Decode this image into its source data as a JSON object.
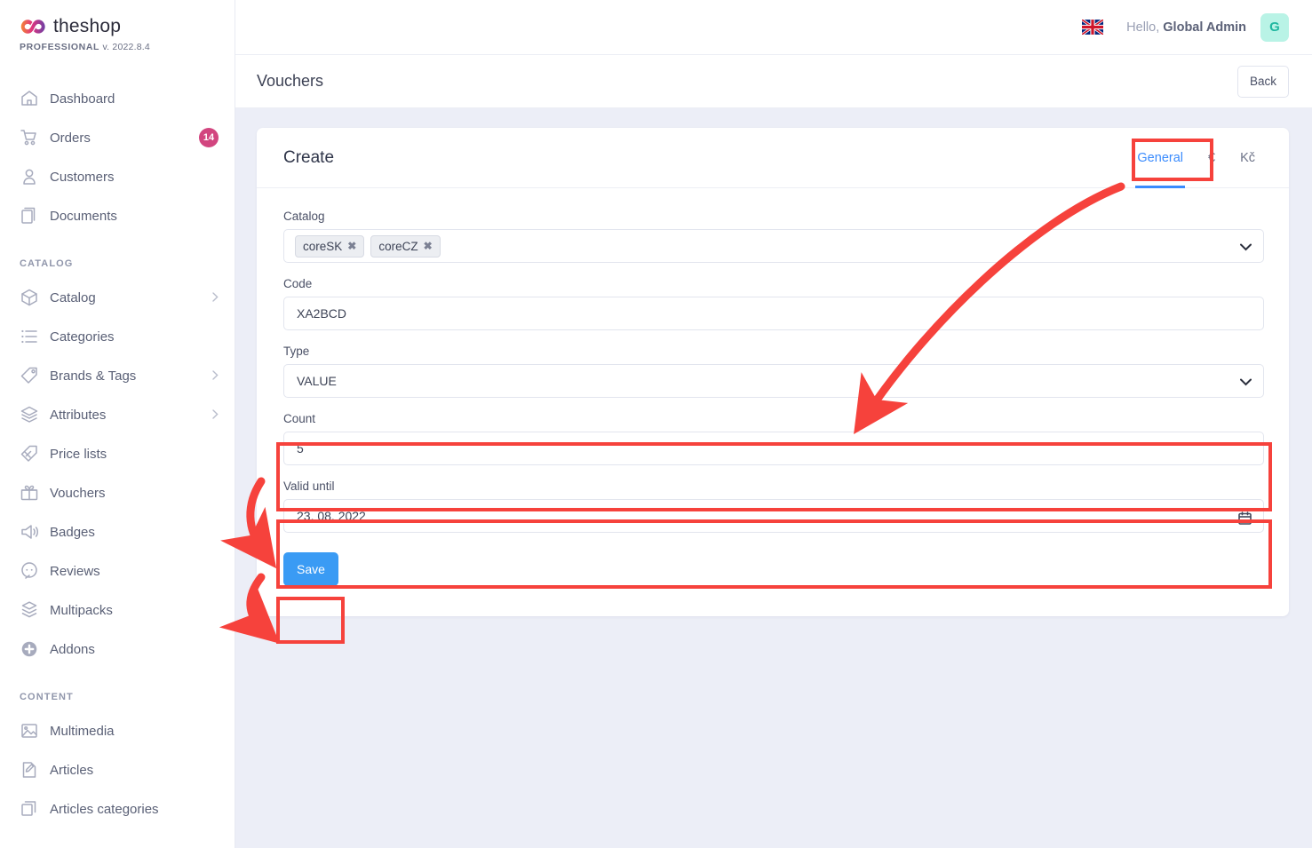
{
  "brand": {
    "name": "theshop",
    "edition": "PROFESSIONAL",
    "version": "v. 2022.8.4",
    "logo_colors": {
      "left": "#f06a3c",
      "mid": "#d63a8f",
      "right": "#6b3fa0"
    }
  },
  "topbar": {
    "language_icon": "uk-flag-icon",
    "greeting_prefix": "Hello,",
    "user_name": "Global Admin",
    "avatar_initial": "G",
    "avatar_bg": "#b9f3e6",
    "avatar_fg": "#20b7a0"
  },
  "page": {
    "title": "Vouchers",
    "back_label": "Back"
  },
  "sidebar": {
    "groups": [
      {
        "label": "",
        "items": [
          {
            "label": "Dashboard",
            "icon": "home-icon",
            "badge": null,
            "chevron": false
          },
          {
            "label": "Orders",
            "icon": "cart-icon",
            "badge": "14",
            "chevron": false
          },
          {
            "label": "Customers",
            "icon": "user-icon",
            "badge": null,
            "chevron": false
          },
          {
            "label": "Documents",
            "icon": "documents-icon",
            "badge": null,
            "chevron": false
          }
        ]
      },
      {
        "label": "CATALOG",
        "items": [
          {
            "label": "Catalog",
            "icon": "box-icon",
            "badge": null,
            "chevron": true
          },
          {
            "label": "Categories",
            "icon": "list-icon",
            "badge": null,
            "chevron": false
          },
          {
            "label": "Brands & Tags",
            "icon": "tag-icon",
            "badge": null,
            "chevron": true
          },
          {
            "label": "Attributes",
            "icon": "layers-icon",
            "badge": null,
            "chevron": true
          },
          {
            "label": "Price lists",
            "icon": "price-tag-icon",
            "badge": null,
            "chevron": false
          },
          {
            "label": "Vouchers",
            "icon": "gift-icon",
            "badge": null,
            "chevron": false
          },
          {
            "label": "Badges",
            "icon": "megaphone-icon",
            "badge": null,
            "chevron": false
          },
          {
            "label": "Reviews",
            "icon": "chat-icon",
            "badge": null,
            "chevron": false
          },
          {
            "label": "Multipacks",
            "icon": "multipack-icon",
            "badge": null,
            "chevron": false
          },
          {
            "label": "Addons",
            "icon": "plus-circle-icon",
            "badge": null,
            "chevron": false
          }
        ]
      },
      {
        "label": "CONTENT",
        "items": [
          {
            "label": "Multimedia",
            "icon": "image-icon",
            "badge": null,
            "chevron": false
          },
          {
            "label": "Articles",
            "icon": "article-icon",
            "badge": null,
            "chevron": false
          },
          {
            "label": "Articles categories",
            "icon": "copy-icon",
            "badge": null,
            "chevron": false
          }
        ]
      }
    ]
  },
  "card": {
    "title": "Create",
    "tabs": [
      {
        "label": "General",
        "active": true
      },
      {
        "label": "€",
        "active": false
      },
      {
        "label": "Kč",
        "active": false
      }
    ],
    "fields": {
      "catalog": {
        "label": "Catalog",
        "chips": [
          "coreSK",
          "coreCZ"
        ],
        "chip_remove_icon": "close-icon",
        "dropdown_icon": "chevron-down-icon"
      },
      "code": {
        "label": "Code",
        "value": "XA2BCD"
      },
      "type": {
        "label": "Type",
        "value": "VALUE",
        "dropdown_icon": "chevron-down-icon"
      },
      "count": {
        "label": "Count",
        "value": "5"
      },
      "valid_until": {
        "label": "Valid until",
        "value": "23. 08. 2022",
        "picker_icon": "calendar-icon"
      }
    },
    "save_label": "Save",
    "save_color": "#3a9bf4"
  },
  "annotations": {
    "highlight_color": "#f6423c",
    "boxes": [
      "general-tab",
      "count-field",
      "valid-until-field",
      "save-button"
    ],
    "arrows": [
      "tab-to-form-arrow",
      "count-to-valid-arrow",
      "valid-to-save-arrow"
    ]
  }
}
